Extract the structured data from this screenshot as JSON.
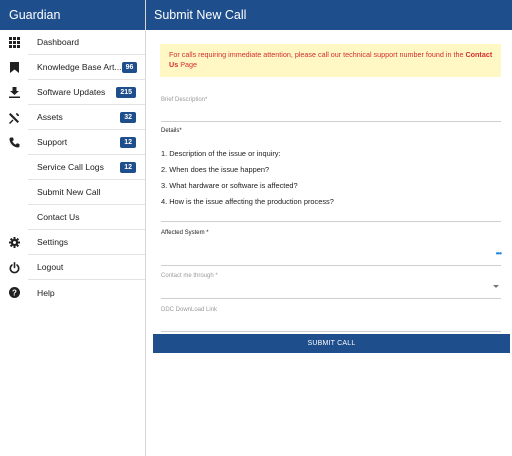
{
  "app_title": "Guardian",
  "page_title": "Submit New Call",
  "sidebar": {
    "items": [
      {
        "label": "Dashboard",
        "icon": "grid-icon",
        "badge": ""
      },
      {
        "label": "Knowledge Base Art...",
        "icon": "bookmark-icon",
        "badge": "96"
      },
      {
        "label": "Software Updates",
        "icon": "download-icon",
        "badge": "215"
      },
      {
        "label": "Assets",
        "icon": "tools-icon",
        "badge": "32"
      },
      {
        "label": "Support",
        "icon": "phone-icon",
        "badge": "12"
      },
      {
        "label": "Service Call Logs",
        "icon": "",
        "badge": "12"
      },
      {
        "label": "Submit New Call",
        "icon": "",
        "badge": ""
      },
      {
        "label": "Contact Us",
        "icon": "",
        "badge": ""
      },
      {
        "label": "Settings",
        "icon": "gear-icon",
        "badge": ""
      },
      {
        "label": "Logout",
        "icon": "power-icon",
        "badge": ""
      },
      {
        "label": "Help",
        "icon": "help-icon",
        "badge": ""
      }
    ]
  },
  "notice": {
    "text": "For calls requiring immediate attention, please call our technical support number found in the ",
    "link": "Contact Us",
    "suffix": " Page"
  },
  "form": {
    "brief_label": "Brief Description*",
    "details_label": "Details*",
    "details_lines": [
      "1. Description of the issue or inquiry:",
      "2. When does the issue happen?",
      "3. What hardware or software is affected?",
      "4. How is the issue affecting the production process?"
    ],
    "affected_label": "Affected System *",
    "affected_more": "•••",
    "contact_label": "Contact me through *",
    "ddc_label": "DDC DownLoad Link",
    "submit_label": "SUBMIT CALL"
  },
  "colors": {
    "primary": "#1e4e8c",
    "notice_bg": "#fff8c4",
    "notice_text": "#d32f2f"
  }
}
